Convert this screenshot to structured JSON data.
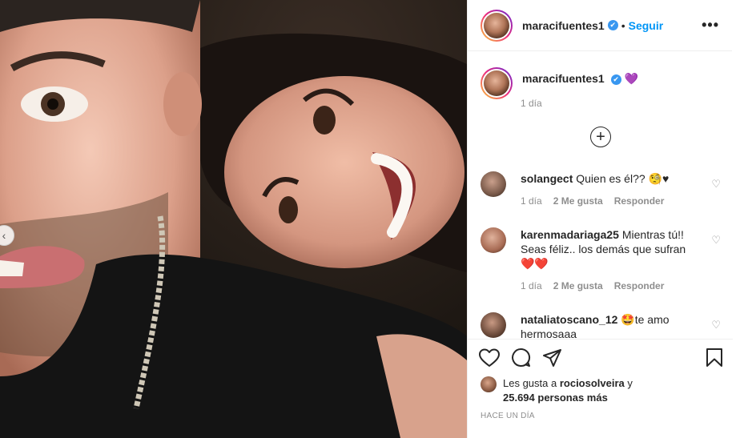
{
  "header": {
    "username": "maracifuentes1",
    "verified_mark": "✔",
    "separator": "•",
    "follow_label": "Seguir",
    "more_label": "•••"
  },
  "caption": {
    "username": "maracifuentes1",
    "emoji": "💜",
    "time": "1 día"
  },
  "load_more_label": "+",
  "comments": [
    {
      "username": "solangect",
      "text": "Quien es él?? 🧐♥",
      "time": "1 día",
      "likes": "2 Me gusta",
      "reply": "Responder",
      "avatar_color": "#7a5a4a"
    },
    {
      "username": "karenmadariaga25",
      "text": "Mientras tú!! Seas féliz.. los demás que sufran",
      "hearts": "❤️❤️",
      "time": "1 día",
      "likes": "2 Me gusta",
      "reply": "Responder",
      "avatar_color": "#a86b54"
    },
    {
      "username": "nataliatoscano_12",
      "text": "🤩te amo hermosaaa",
      "avatar_color": "#6b4a3a"
    }
  ],
  "comment_like_icon": "♡",
  "actions": {
    "icons": [
      "heart-outline-icon",
      "comment-icon",
      "share-icon",
      "bookmark-icon"
    ]
  },
  "likes": {
    "prefix": "Les gusta a",
    "user": "rociosolveira",
    "suffix": "y",
    "count_text": "25.694 personas más"
  },
  "posted_ago": "HACE UN DÍA",
  "nav_arrow": "‹"
}
